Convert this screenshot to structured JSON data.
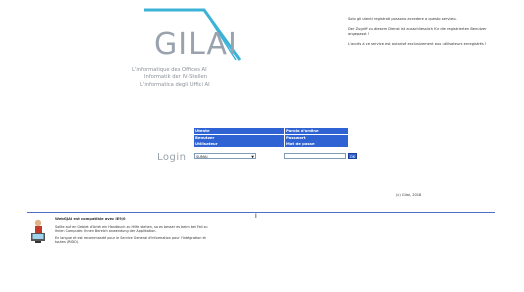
{
  "brand": {
    "logo_text": "GILAI",
    "subtitles": [
      "L'informatique des Offices AI",
      "Informatik der IV-Stellen",
      "L'informatica degli Uffici AI"
    ]
  },
  "notice": {
    "p1": "Solo gli utenti registrati possono accedere a questo servizio.",
    "p2": "Der Zugriff zu diesem Dienst ist ausschliesslich für die registrierten Benutzer angepasst !",
    "p3": "L'accès à ce service est autorisé exclusivement aux utilisateurs enregistrés !"
  },
  "login": {
    "label": "Login",
    "grid": [
      {
        "left": "Utente",
        "right": "Parola d'ordine"
      },
      {
        "left": "Benutzer",
        "right": "Passwort"
      },
      {
        "left": "Utilisateur",
        "right": "Mot de passe"
      }
    ],
    "user_select_value": "SUMAI",
    "ok_label": "OK"
  },
  "footer": {
    "copyright": "(c) Gilai, 2018"
  },
  "info": {
    "title": "WebGJAI est compatible avec IE9/0",
    "p1": "Sollte auf en Gebiet d'Ariet ein Handbuch zu Hilfe stehen, so es besser es beim bei Fall zu Ihnen Computer. Ihnen Bereich anwendung der Applikation.",
    "p2": "En langue et est recommandé pour le Service General d'information pour l'Intégration et toutes (RIDO)."
  },
  "icons": {
    "logo_mark": "gilai-logo-arc",
    "info_figure": "person-at-computer-icon",
    "cursor": "text-cursor-icon"
  }
}
